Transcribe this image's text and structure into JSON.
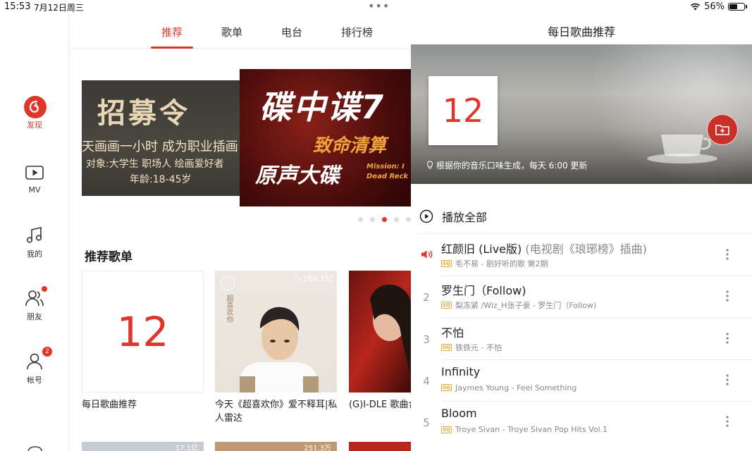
{
  "status": {
    "time": "15:53",
    "date": "7月12日周三",
    "battery": "56%",
    "battery_level": 0.56
  },
  "sidebar": {
    "items": [
      {
        "label": "发现",
        "icon": "netease-logo-icon",
        "active": true
      },
      {
        "label": "MV",
        "icon": "video-play-icon"
      },
      {
        "label": "我的",
        "icon": "music-note-icon"
      },
      {
        "label": "朋友",
        "icon": "friends-icon",
        "badge_dot": true
      },
      {
        "label": "帐号",
        "icon": "account-icon",
        "badge": "2"
      }
    ]
  },
  "tabs": [
    "推荐",
    "歌单",
    "电台",
    "排行榜"
  ],
  "active_tab": "推荐",
  "banner": {
    "left": {
      "title": "招募令",
      "line1": "天画画一小时 成为职业插画",
      "line2": "对象:大学生 职场人 绘画爱好者",
      "line3": "年龄:18-45岁"
    },
    "main": {
      "title": "碟中谍7",
      "subtitle": "致命清算",
      "line": "原声大碟",
      "eng": "Mission: I\nDead Reck"
    }
  },
  "section": {
    "title": "推荐歌单"
  },
  "playlists": [
    {
      "cover_number": "12",
      "caption": "每日歌曲推荐"
    },
    {
      "play_count": "160.1亿",
      "caption": "今天《超喜欢你》爱不释耳|私人雷达",
      "cover_text": "超喜欢你"
    },
    {
      "caption": "(G)I-DLE 歌曲合"
    }
  ],
  "more_counts": [
    "17.1亿",
    "251.3万"
  ],
  "panel": {
    "title": "每日歌曲推荐",
    "date_number": "12",
    "note": "根据你的音乐口味生成，每天 6:00 更新",
    "play_all": "播放全部"
  },
  "songs": [
    {
      "index": "",
      "playing": true,
      "title": "红颜旧 (Live版)",
      "alias": " (电视剧《琅琊榜》插曲)",
      "quality": "SQ",
      "subtitle": "毛不易 - 剧好听的歌 第2期"
    },
    {
      "index": "2",
      "title": "罗生门（Follow)",
      "alias": "",
      "quality": "SQ",
      "subtitle": "梨冻紧 /Wiz_H张子豪 - 罗生门（Follow)"
    },
    {
      "index": "3",
      "title": "不怕",
      "alias": "",
      "quality": "SQ",
      "subtitle": "铁铁元 - 不怕"
    },
    {
      "index": "4",
      "title": "Infinity",
      "alias": "",
      "quality": "SQ",
      "subtitle": "Jaymes Young - Feel Something"
    },
    {
      "index": "5",
      "title": "Bloom",
      "alias": "",
      "quality": "SQ",
      "subtitle": "Troye Sivan - Troye Sivan Pop Hits Vol.1"
    }
  ],
  "colors": {
    "accent": "#d33a31",
    "quality_badge": "#e3a84a"
  }
}
